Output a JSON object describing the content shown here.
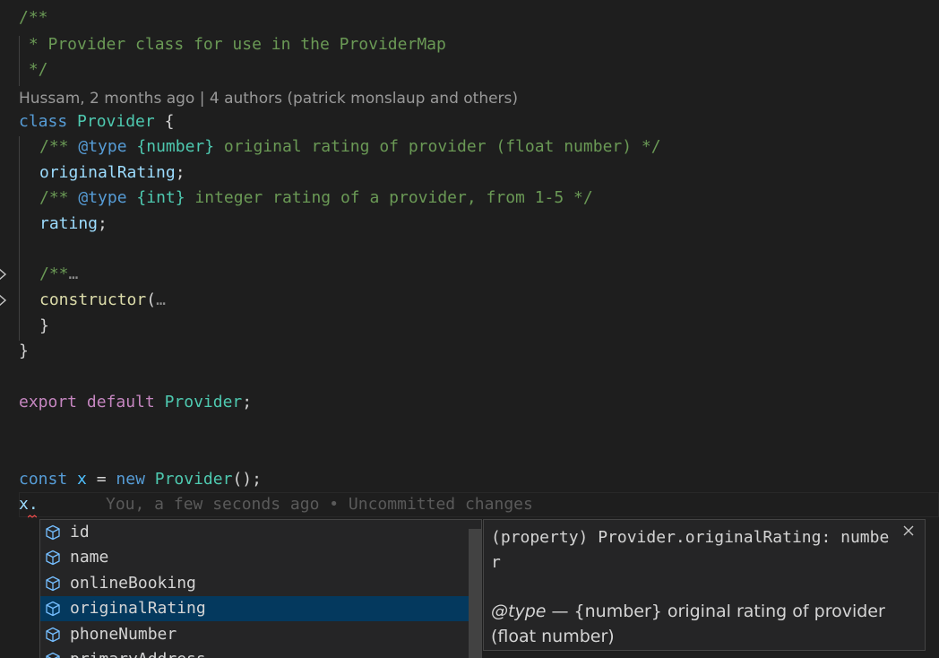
{
  "code": {
    "doc_open": "/**",
    "doc_line": " * Provider class for use in the ProviderMap",
    "doc_close": " */",
    "codelens": "Hussam, 2 months ago | 4 authors (patrick monslaup and others)",
    "class_kw": "class",
    "class_name": "Provider",
    "brace_open": " {",
    "c1_open": "/** ",
    "c1_tag": "@type",
    "c1_type": "{number}",
    "c1_text": " original rating of provider (float number) */",
    "prop1": "originalRating",
    "semi": ";",
    "c2_open": "/** ",
    "c2_tag": "@type",
    "c2_type": "{int}",
    "c2_text": " integer rating of a provider, from 1-5 */",
    "prop2": "rating",
    "folded_comment": "/**",
    "ellipsis": "…",
    "ctor": "constructor",
    "ctor_paren": "(",
    "inner_brace": "}",
    "outer_brace": "}",
    "export_kw": "export",
    "default_kw": "default",
    "export_name": "Provider",
    "const_kw": "const",
    "x_var": "x",
    "eq": " = ",
    "new_kw": "new",
    "new_class": "Provider",
    "call": "();",
    "current_line": "x.",
    "blame": "You, a few seconds ago • Uncommitted changes"
  },
  "suggest": {
    "items": [
      {
        "label": "id",
        "icon": "property-icon"
      },
      {
        "label": "name",
        "icon": "property-icon"
      },
      {
        "label": "onlineBooking",
        "icon": "property-icon"
      },
      {
        "label": "originalRating",
        "icon": "property-icon",
        "selected": true
      },
      {
        "label": "phoneNumber",
        "icon": "property-icon"
      },
      {
        "label": "primaryAddress",
        "icon": "property-icon"
      }
    ]
  },
  "details": {
    "signature": "(property) Provider.originalRating: number",
    "doc_tag": "@type",
    "doc_text": " — {number} original rating of provider (float number)"
  },
  "colors": {
    "comment": "#6a9955",
    "keyword": "#569cd6",
    "control": "#c586c0",
    "type": "#4ec9b0",
    "property": "#9cdcfe",
    "function": "#dcdcaa",
    "selection": "#04395e"
  }
}
